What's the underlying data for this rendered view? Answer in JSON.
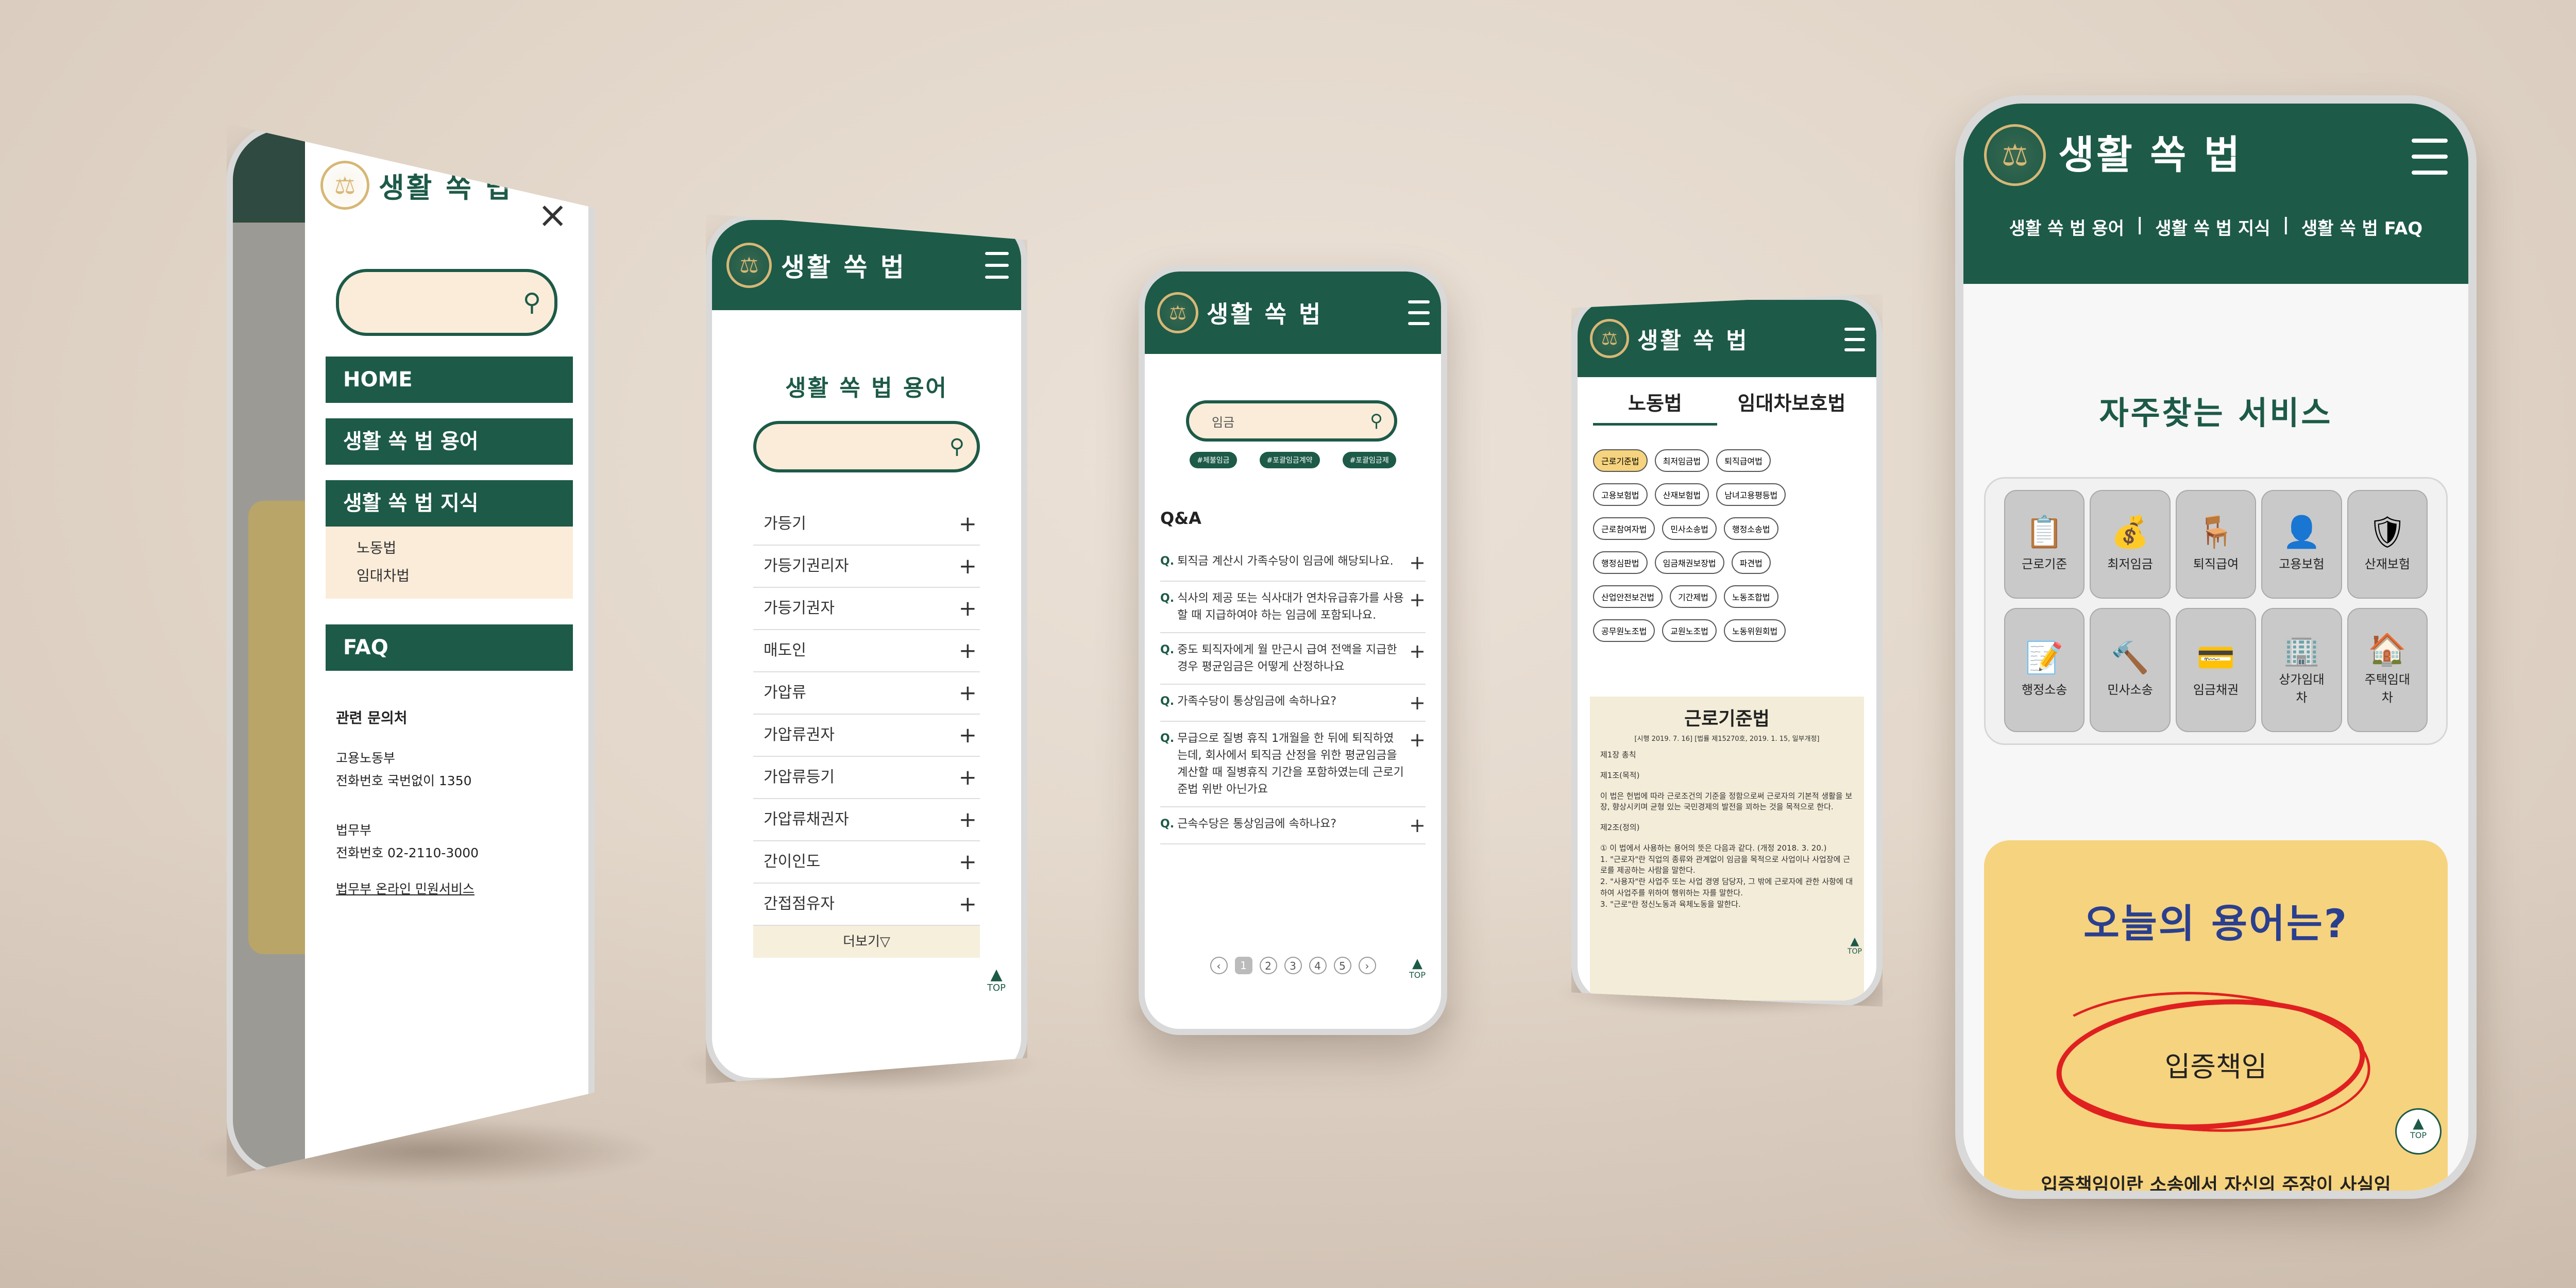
{
  "brand": {
    "name": "생활 쏙 법"
  },
  "menu_phone": {
    "close_label": "×",
    "nav": {
      "home": "HOME",
      "terms": "생활 쏙 법 용어",
      "knowledge": "생활 쏙 법 지식",
      "faq": "FAQ"
    },
    "submenu": [
      "노동법",
      "임대차법"
    ],
    "contact_title": "관련 문의처",
    "moel": {
      "name": "고용노동부",
      "phone": "전화번호  국번없이 1350"
    },
    "moj": {
      "name": "법무부",
      "phone": "전화번호  02-2110-3000",
      "link": "법무부 온라인 민원서비스"
    }
  },
  "terms_phone": {
    "title": "생활 쏙 법 용어",
    "items": [
      "가등기",
      "가등기권리자",
      "가등기권자",
      "매도인",
      "가압류",
      "가압류권자",
      "가압류등기",
      "가압류채권자",
      "간이인도",
      "간접점유자"
    ],
    "more": "더보기▽",
    "top": "TOP"
  },
  "qa_phone": {
    "search_value": "임금",
    "tags": [
      "#체불임금",
      "#포괄임금계약",
      "#포괄임금제"
    ],
    "section": "Q&A",
    "q_prefix": "Q.",
    "questions": [
      "퇴직금 계산시 가족수당이 임금에 해당되나요.",
      "식사의 제공 또는 식사대가 연차유급휴가를 사용할 때 지급하여야 하는 임금에 포함되나요.",
      "중도 퇴직자에게 월 만근시 급여 전액을 지급한 경우 평균임금은 어떻게 산정하나요",
      "가족수당이 통상임금에 속하나요?",
      "무급으로 질병 휴직 1개월을 한 뒤에 퇴직하였는데, 회사에서 퇴직금 산정을 위한 평균임금을 계산할 때 질병휴직 기간을 포함하였는데 근로기준법 위반 아닌가요",
      "근속수당은 통상임금에 속하나요?"
    ],
    "pages": [
      "1",
      "2",
      "3",
      "4",
      "5"
    ],
    "prev": "‹",
    "next": "›",
    "top": "TOP"
  },
  "law_phone": {
    "tabs": [
      "노동법",
      "임대차보호법"
    ],
    "chips": [
      "근로기준법",
      "최저임금법",
      "퇴직급여법",
      "고용보험법",
      "산재보험법",
      "남녀고용평등법",
      "근로참여자법",
      "민사소송법",
      "행정소송법",
      "행정심판법",
      "임금채권보장법",
      "파견법",
      "산업안전보건법",
      "기간제법",
      "노동조합법",
      "공무원노조법",
      "교원노조법",
      "노동위원회법"
    ],
    "doc_title": "근로기준법",
    "doc_meta": "[시행 2019. 7. 16] [법률 제15270호, 2019. 1. 15, 일부개정]",
    "chapter": "제1장 총칙",
    "art1_title": "제1조(목적)",
    "art1_body": "이 법은 헌법에 따라 근로조건의 기준을 정함으로써 근로자의 기본적 생활을 보장, 향상시키며 균형 있는 국민경제의 발전을 꾀하는 것을 목적으로 한다.",
    "art2_title": "제2조(정의)",
    "art2_body1": "① 이 법에서 사용하는 용어의 뜻은 다음과 같다. (개정 2018. 3. 20.)",
    "art2_body2": "1. \"근로자\"란 직업의 종류와 관계없이 임금을 목적으로 사업이나 사업장에 근로를 제공하는 사람을 말한다.",
    "art2_body3": "2. \"사용자\"란 사업주 또는 사업 경영 담당자, 그 밖에 근로자에 관한 사항에 대하여 사업주를 위하여 행위하는 자를 말한다.",
    "art2_body4": "3. \"근로\"란 정신노동과 육체노동을 말한다.",
    "top": "TOP"
  },
  "main_phone": {
    "nav": [
      "생활 쏙 법 용어",
      "생활 쏙 법 지식",
      "생활 쏙 법 FAQ"
    ],
    "divider": "|",
    "services_title": "자주찾는 서비스",
    "services": [
      "근로기준",
      "최저임금",
      "퇴직급여",
      "고용보험",
      "산재보험",
      "행정소송",
      "민사소송",
      "임금채권",
      "상가임대차",
      "주택임대차"
    ],
    "today_title": "오늘의 용어는?",
    "today_term": "입증책임",
    "today_desc": "입증책임이란 소송에서 자신의 주장이 사실임",
    "top": "TOP"
  },
  "colors": {
    "green": "#1d5a48",
    "gold": "#d7b776",
    "cream": "#fbecd9",
    "yellow": "#f6d37e",
    "red": "#e02020",
    "blue": "#2a3f8f"
  },
  "icons": [
    "logo-scales-icon",
    "hamburger-icon",
    "close-icon",
    "search-icon",
    "plus-icon",
    "top-arrow-icon",
    "service-icons"
  ]
}
